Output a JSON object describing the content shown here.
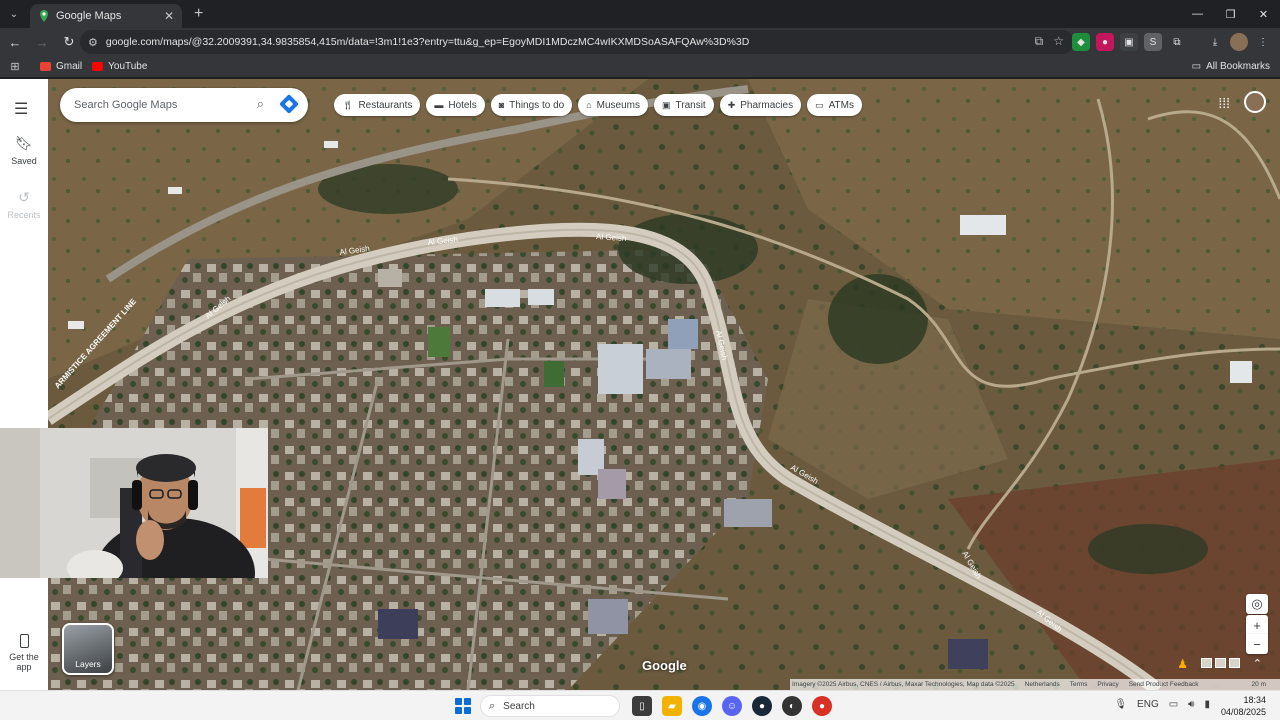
{
  "browser": {
    "tab_title": "Google Maps",
    "url": "google.com/maps/@32.2009391,34.9835854,415m/data=!3m1!1e3?entry=ttu&g_ep=EgoyMDI1MDczMC4wIKXMDSoASAFQAw%3D%3D",
    "bookmarks": [
      {
        "label": "Gmail"
      },
      {
        "label": "YouTube"
      }
    ],
    "all_bookmarks_label": "All Bookmarks"
  },
  "maps": {
    "sidebar": {
      "saved_label": "Saved",
      "recents_label": "Recents",
      "get_app_label_1": "Get the",
      "get_app_label_2": "app"
    },
    "search": {
      "placeholder": "Search Google Maps"
    },
    "chips": [
      {
        "label": "Restaurants",
        "icon": "fork-knife-icon"
      },
      {
        "label": "Hotels",
        "icon": "bed-icon"
      },
      {
        "label": "Things to do",
        "icon": "camera-icon"
      },
      {
        "label": "Museums",
        "icon": "museum-icon"
      },
      {
        "label": "Transit",
        "icon": "train-icon"
      },
      {
        "label": "Pharmacies",
        "icon": "pharmacy-icon"
      },
      {
        "label": "ATMs",
        "icon": "atm-icon"
      }
    ],
    "layers_label": "Layers",
    "google_logo": "Google",
    "road_labels": {
      "r1": "Al Geish",
      "r2": "Al Geish",
      "r3": "Al Geish",
      "r4": "Al Geish",
      "r5": "Al Geish",
      "r6": "Al Geish",
      "r7": "Al Geish",
      "armistice": "ARMISTICE AGREEMENT LINE",
      "r9": "Al Geish"
    },
    "attribution": {
      "imagery": "Imagery ©2025 Airbus, CNES / Airbus, Maxar Technologies, Map data ©2025",
      "country": "Netherlands",
      "terms": "Terms",
      "privacy": "Privacy",
      "feedback": "Send Product Feedback",
      "scale": "20 m"
    }
  },
  "taskbar": {
    "search_label": "Search",
    "language": "ENG",
    "time": "18:34",
    "date": "04/08/2025"
  },
  "colors": {
    "accent": "#1a73e8",
    "chrome_dark": "#202124",
    "chrome_mid": "#35363a"
  }
}
